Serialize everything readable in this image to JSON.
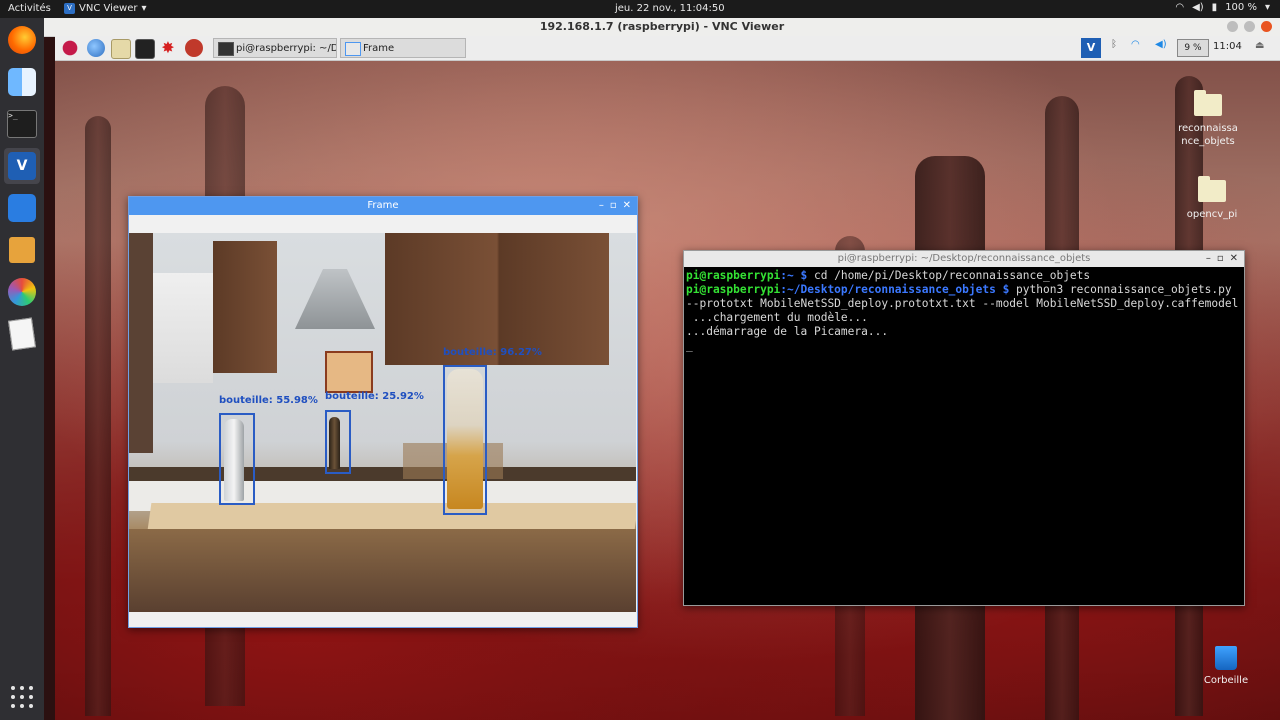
{
  "topbar": {
    "activities": "Activités",
    "app_name": "VNC Viewer",
    "clock": "jeu. 22 nov., 11:04:50",
    "battery": "100 %"
  },
  "vnc": {
    "title": "192.168.1.7 (raspberrypi) - VNC Viewer"
  },
  "rpi_taskbar": {
    "tasks": [
      "pi@raspberrypi: ~/De...",
      "Frame"
    ],
    "cpu": "9 %",
    "time": "11:04"
  },
  "frame_window": {
    "title": "Frame",
    "detections": [
      {
        "label": "bouteille: 55.98%"
      },
      {
        "label": "bouteille: 25.92%"
      },
      {
        "label": "bouteille: 96.27%"
      }
    ]
  },
  "terminal": {
    "title": "pi@raspberrypi: ~/Desktop/reconnaissance_objets",
    "lines": [
      {
        "user": "pi@raspberrypi",
        "path": ":~ $",
        "cmd": " cd /home/pi/Desktop/reconnaissance_objets"
      },
      {
        "user": "pi@raspberrypi",
        "path": ":~/Desktop/reconnaissance_objets $",
        "cmd": " python3 reconnaissance_objets.py --prototxt MobileNetSSD_deploy.prototxt.txt --model MobileNetSSD_deploy.caffemodel"
      }
    ],
    "output": [
      " ...chargement du modèle...",
      "...démarrage de la Picamera...",
      "_"
    ]
  },
  "desktop_icons": [
    {
      "label": "reconnaissance_objets",
      "icon": "folder-icon"
    },
    {
      "label": "opencv_pi",
      "icon": "folder-icon"
    },
    {
      "label": "Corbeille",
      "icon": "trash-icon"
    }
  ],
  "colors": {
    "detection_box": "#2a5cc4",
    "frame_titlebar": "#4e97f0",
    "prompt_user": "#34e234",
    "prompt_path": "#3b78ff"
  }
}
